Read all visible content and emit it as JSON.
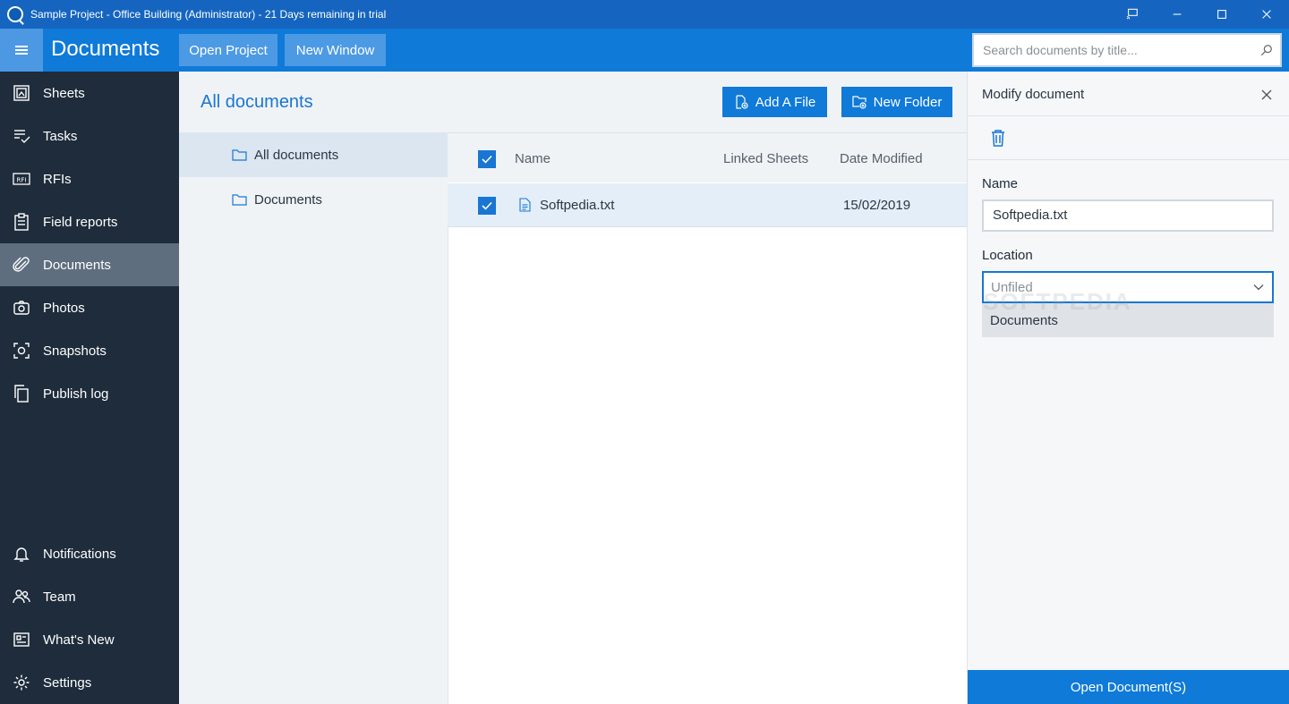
{
  "window": {
    "title": "Sample Project - Office Building (Administrator) - 21 Days remaining in trial"
  },
  "header": {
    "title": "Documents",
    "open_project_label": "Open Project",
    "new_window_label": "New Window",
    "search_placeholder": "Search documents by title..."
  },
  "sidebar": {
    "top_items": [
      {
        "label": "Sheets",
        "icon": "sheets-icon"
      },
      {
        "label": "Tasks",
        "icon": "tasks-icon"
      },
      {
        "label": "RFIs",
        "icon": "rfi-icon"
      },
      {
        "label": "Field reports",
        "icon": "clipboard-icon"
      },
      {
        "label": "Documents",
        "icon": "paperclip-icon",
        "active": true
      },
      {
        "label": "Photos",
        "icon": "camera-icon"
      },
      {
        "label": "Snapshots",
        "icon": "snapshot-icon"
      },
      {
        "label": "Publish log",
        "icon": "copy-icon"
      }
    ],
    "bottom_items": [
      {
        "label": "Notifications",
        "icon": "bell-icon"
      },
      {
        "label": "Team",
        "icon": "team-icon"
      },
      {
        "label": "What's New",
        "icon": "news-icon"
      },
      {
        "label": "Settings",
        "icon": "gear-icon"
      }
    ]
  },
  "folders": {
    "heading": "All documents",
    "items": [
      {
        "label": "All documents",
        "selected": true
      },
      {
        "label": "Documents",
        "selected": false
      }
    ]
  },
  "actions": {
    "add_file_label": "Add A File",
    "new_folder_label": "New Folder"
  },
  "table": {
    "columns": [
      "Name",
      "Linked Sheets",
      "Date Modified"
    ],
    "rows": [
      {
        "name": "Softpedia.txt",
        "linked_sheets": "",
        "date_modified": "15/02/2019",
        "checked": true
      }
    ]
  },
  "modify_panel": {
    "title": "Modify document",
    "name_label": "Name",
    "name_value": "Softpedia.txt",
    "location_label": "Location",
    "location_value": "Unfiled",
    "location_option": "Documents",
    "watermark": "SOFTPEDIA",
    "open_button_label": "Open Document(S)"
  },
  "colors": {
    "accent": "#0f7ad8",
    "titlebar": "#1565c0",
    "sidebar": "#1e2c3b"
  }
}
